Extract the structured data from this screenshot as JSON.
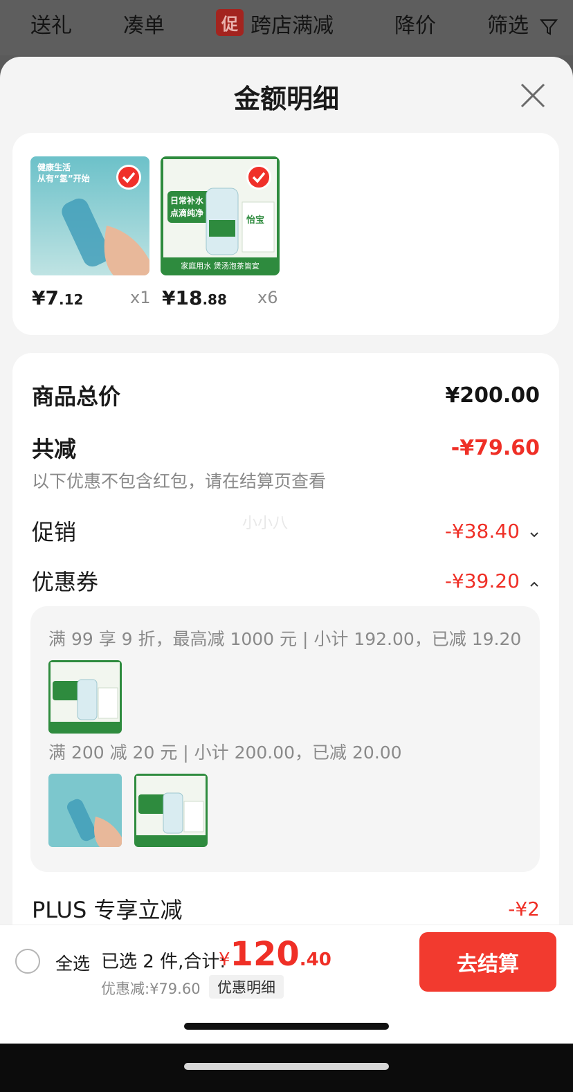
{
  "top_tabs": [
    {
      "label": "送礼"
    },
    {
      "label": "凑单"
    },
    {
      "badge": "促",
      "label": "跨店满减"
    },
    {
      "label": "降价"
    },
    {
      "label": "筛选"
    }
  ],
  "sheet": {
    "title": "金额明细",
    "products": [
      {
        "image_lines": [
          "健康生活",
          "从有“氢”开始"
        ],
        "price_int": "¥7",
        "price_dec": ".12",
        "qty": "x1",
        "checked": true
      },
      {
        "image_lines": [
          "日常补水",
          "点滴纯净",
          "怡宝",
          "家庭用水 煲汤泡茶皆宜"
        ],
        "price_int": "¥18",
        "price_dec": ".88",
        "qty": "x6",
        "checked": true
      }
    ],
    "summary": {
      "total_label": "商品总价",
      "total_value": "¥200.00",
      "reduce_label": "共减",
      "reduce_value": "-¥79.60",
      "note": "以下优惠不包含红包，请在结算页查看",
      "watermark": "小小八",
      "promo_label": "促销",
      "promo_value": "-¥38.40",
      "coupon_label": "优惠券",
      "coupon_value": "-¥39.20",
      "plus_label": "PLUS 专享立减",
      "plus_value": "-¥2"
    },
    "coupons": [
      {
        "text": "满 99 享 9 折，最高减 1000 元 | 小计 192.00，已减 19.20"
      },
      {
        "text": "满 200 减 20 元 | 小计 200.00，已减 20.00"
      }
    ]
  },
  "bottom_bar": {
    "select_all": "全选",
    "selected_text": "已选 2 件,合计:",
    "total_currency": "¥",
    "total_int": "120",
    "total_dec": ".40",
    "discount_text": "优惠减:¥79.60",
    "detail_link": "优惠明细",
    "checkout": "去结算"
  },
  "colors": {
    "accent_red": "#ef2f26",
    "checkout_red": "#f23a2f",
    "water_green": "#2e8b3e",
    "water_blue": "#6fc0c8"
  }
}
